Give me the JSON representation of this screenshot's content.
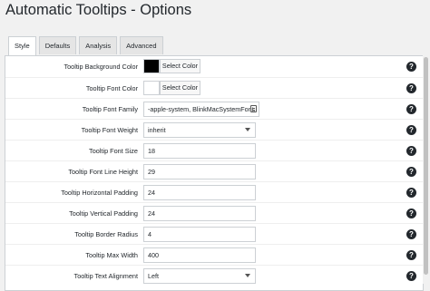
{
  "page": {
    "title": "Automatic Tooltips - Options"
  },
  "tabs": [
    {
      "label": "Style",
      "active": true
    },
    {
      "label": "Defaults",
      "active": false
    },
    {
      "label": "Analysis",
      "active": false
    },
    {
      "label": "Advanced",
      "active": false
    }
  ],
  "settings": {
    "bg_color": {
      "label": "Tooltip Background Color",
      "swatch": "#000000",
      "button": "Select Color"
    },
    "font_color": {
      "label": "Tooltip Font Color",
      "swatch": "#ffffff",
      "button": "Select Color"
    },
    "font_family": {
      "label": "Tooltip Font Family",
      "value": "-apple-system, BlinkMacSystemFont,"
    },
    "font_weight": {
      "label": "Tooltip Font Weight",
      "value": "inherit"
    },
    "font_size": {
      "label": "Tooltip Font Size",
      "value": "18"
    },
    "line_height": {
      "label": "Tooltip Font Line Height",
      "value": "29"
    },
    "h_padding": {
      "label": "Tooltip Horizontal Padding",
      "value": "24"
    },
    "v_padding": {
      "label": "Tooltip Vertical Padding",
      "value": "24"
    },
    "border_radius": {
      "label": "Tooltip Border Radius",
      "value": "4"
    },
    "max_width": {
      "label": "Tooltip Max Width",
      "value": "400"
    },
    "text_align": {
      "label": "Tooltip Text Alignment",
      "value": "Left"
    }
  },
  "help_icon_glyph": "?",
  "colors": {
    "accent_text": "#23282d",
    "border": "#ccd0d4",
    "background": "#f1f1f1"
  }
}
